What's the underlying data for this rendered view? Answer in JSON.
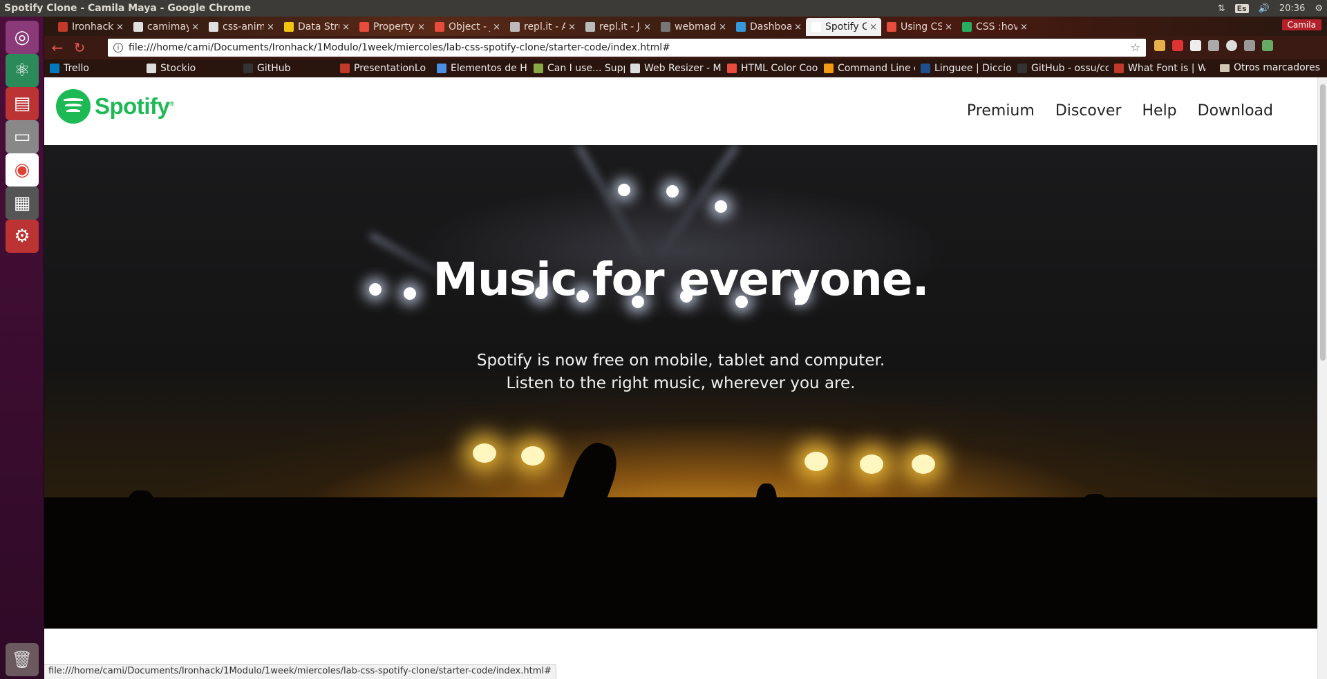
{
  "os": {
    "window_title": "Spotify Clone - Camila Maya - Google Chrome",
    "tray": {
      "keyboard": "Es",
      "time": "20:36"
    }
  },
  "launcher": {
    "items": [
      "ubuntu-dash",
      "atom-editor",
      "screen-recorder",
      "file-manager",
      "chrome",
      "calculator",
      "system-settings",
      "trash"
    ]
  },
  "browser": {
    "tabs": [
      {
        "label": "Ironhack S",
        "color": "#c0392b"
      },
      {
        "label": "camimaya",
        "color": "#e0e0e0"
      },
      {
        "label": "css-anima",
        "color": "#e0e0e0"
      },
      {
        "label": "Data Struc",
        "color": "#f1c40f"
      },
      {
        "label": "Property",
        "color": "#e74c3c"
      },
      {
        "label": "Object - J",
        "color": "#e74c3c"
      },
      {
        "label": "repl.it - Ar",
        "color": "#bbbbbb"
      },
      {
        "label": "repl.it - Ja",
        "color": "#bbbbbb"
      },
      {
        "label": "webmad",
        "color": "#777777"
      },
      {
        "label": "Dashboar",
        "color": "#3498db"
      },
      {
        "label": "Spotify Cl",
        "color": "#ffffff"
      },
      {
        "label": "Using CSS",
        "color": "#e74c3c"
      },
      {
        "label": "CSS :hover",
        "color": "#27ae60"
      }
    ],
    "profile_name": "Camila",
    "url": "file:///home/cami/Documents/Ironhack/1Modulo/1week/miercoles/lab-css-spotify-clone/starter-code/index.html#",
    "bookmarks": [
      {
        "label": "Trello",
        "color": "#0079bf"
      },
      {
        "label": "Stockio",
        "color": "#dddddd"
      },
      {
        "label": "GitHub",
        "color": "#333333"
      },
      {
        "label": "PresentationLo",
        "color": "#c0392b"
      },
      {
        "label": "Elementos de H",
        "color": "#4a90e2"
      },
      {
        "label": "Can I use... Supp",
        "color": "#8aa844"
      },
      {
        "label": "Web Resizer - M",
        "color": "#dddddd"
      },
      {
        "label": "HTML Color Coo",
        "color": "#e74c3c"
      },
      {
        "label": "Command Line c",
        "color": "#f39c12"
      },
      {
        "label": "Linguee | Diccio",
        "color": "#1f4e8c"
      },
      {
        "label": "GitHub - ossu/co",
        "color": "#333333"
      },
      {
        "label": "What Font is | W",
        "color": "#c0392b"
      }
    ],
    "other_bookmarks": "Otros marcadores",
    "status_url": "file:///home/cami/Documents/Ironhack/1Modulo/1week/miercoles/lab-css-spotify-clone/starter-code/index.html#"
  },
  "site": {
    "brand": "Spotify",
    "brand_color": "#1db954",
    "nav": [
      "Premium",
      "Discover",
      "Help",
      "Download"
    ],
    "hero": {
      "title": "Music for everyone.",
      "subtitle_line1": "Spotify is now free on mobile, tablet and computer.",
      "subtitle_line2": "Listen to the right music, wherever you are."
    }
  }
}
